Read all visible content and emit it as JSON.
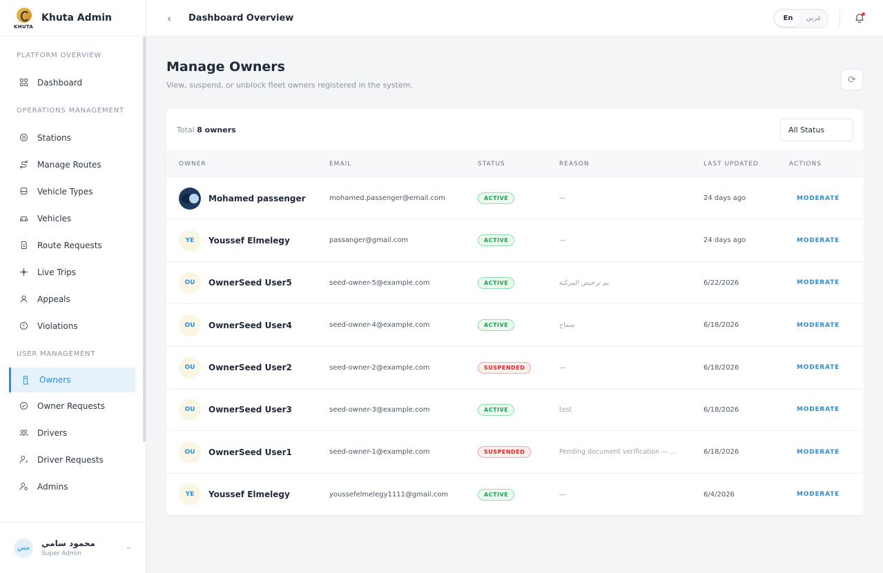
{
  "app": {
    "brand_name": "Khuta Admin",
    "logo_word": "KHUTA"
  },
  "sidebar": {
    "sections": [
      {
        "title": "PLATFORM OVERVIEW",
        "items": [
          {
            "label": "Dashboard",
            "icon": "grid-icon"
          }
        ]
      },
      {
        "title": "OPERATIONS MANAGEMENT",
        "items": [
          {
            "label": "Stations",
            "icon": "location-pin-icon"
          },
          {
            "label": "Manage Routes",
            "icon": "route-icon"
          },
          {
            "label": "Vehicle Types",
            "icon": "bus-icon"
          },
          {
            "label": "Vehicles",
            "icon": "car-icon"
          },
          {
            "label": "Route Requests",
            "icon": "route-request-icon"
          },
          {
            "label": "Live Trips",
            "icon": "live-trips-icon"
          },
          {
            "label": "Appeals",
            "icon": "appeals-icon"
          },
          {
            "label": "Violations",
            "icon": "alert-circle-icon"
          }
        ]
      },
      {
        "title": "USER MANAGEMENT",
        "items": [
          {
            "label": "Owners",
            "icon": "owner-icon",
            "active": true
          },
          {
            "label": "Owner Requests",
            "icon": "check-circle-icon"
          },
          {
            "label": "Drivers",
            "icon": "users-icon"
          },
          {
            "label": "Driver Requests",
            "icon": "user-request-icon"
          },
          {
            "label": "Admins",
            "icon": "admin-icon"
          }
        ]
      }
    ],
    "user": {
      "initials": "مس",
      "name": "محمود سامي",
      "role": "Super Admin"
    }
  },
  "topbar": {
    "title": "Dashboard Overview",
    "lang_en": "En",
    "lang_ar": "عربي"
  },
  "page": {
    "title": "Manage Owners",
    "subtitle": "View, suspend, or unblock fleet owners registered in the system."
  },
  "table": {
    "total_prefix": "Total",
    "total_count": "8 owners",
    "filter_value": "All Status",
    "columns": [
      "OWNER",
      "EMAIL",
      "STATUS",
      "REASON",
      "LAST UPDATED",
      "ACTIONS"
    ],
    "rows": [
      {
        "initials": "",
        "image": true,
        "name": "Mohamed passenger",
        "email": "mohamed.passenger@email.com",
        "status": "ACTIVE",
        "reason": "—",
        "updated": "24 days ago",
        "action": "MODERATE"
      },
      {
        "initials": "YE",
        "name": "Youssef Elmelegy",
        "email": "passanger@gmail.com",
        "status": "ACTIVE",
        "reason": "—",
        "updated": "24 days ago",
        "action": "MODERATE"
      },
      {
        "initials": "OU",
        "name": "OwnerSeed User5",
        "email": "seed-owner-5@example.com",
        "status": "ACTIVE",
        "reason": "تم ترخيص المركبة",
        "updated": "6/22/2026",
        "action": "MODERATE"
      },
      {
        "initials": "OU",
        "name": "OwnerSeed User4",
        "email": "seed-owner-4@example.com",
        "status": "ACTIVE",
        "reason": "سماح",
        "updated": "6/18/2026",
        "action": "MODERATE"
      },
      {
        "initials": "OU",
        "name": "OwnerSeed User2",
        "email": "seed-owner-2@example.com",
        "status": "SUSPENDED",
        "reason": "—",
        "updated": "6/18/2026",
        "action": "MODERATE"
      },
      {
        "initials": "OU",
        "name": "OwnerSeed User3",
        "email": "seed-owner-3@example.com",
        "status": "ACTIVE",
        "reason": "test",
        "updated": "6/18/2026",
        "action": "MODERATE"
      },
      {
        "initials": "OU",
        "name": "OwnerSeed User1",
        "email": "seed-owner-1@example.com",
        "status": "SUSPENDED",
        "reason": "Pending document verification — ...",
        "updated": "6/18/2026",
        "action": "MODERATE"
      },
      {
        "initials": "YE",
        "name": "Youssef Elmelegy",
        "email": "youssefelmelegy1111@gmail.com",
        "status": "ACTIVE",
        "reason": "—",
        "updated": "6/4/2026",
        "action": "MODERATE"
      }
    ]
  },
  "colors": {
    "accent": "#2b8ed6",
    "active": "#16a34a",
    "suspended": "#dc2626"
  }
}
